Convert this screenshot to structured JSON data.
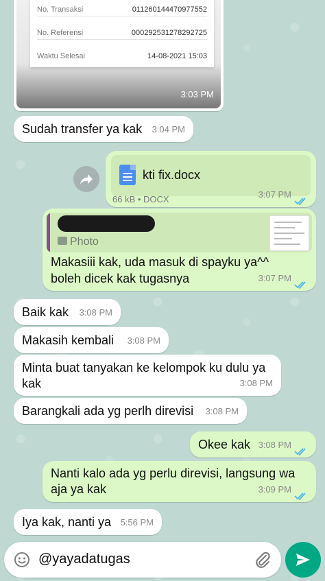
{
  "receipt": {
    "rows": [
      {
        "label": "No. Transaksi",
        "value": "011260144470977552"
      },
      {
        "label": "No. Referensi",
        "value": "000292531278292725"
      },
      {
        "label": "Waktu Selesai",
        "value": "14-08-2021 15:03"
      }
    ],
    "time": "3:03 PM"
  },
  "messages": [
    {
      "text": "Sudah transfer ya kak",
      "time": "3:04 PM"
    },
    {
      "file_name": "kti fix.docx",
      "file_meta": "66 kB • DOCX",
      "time": "3:07 PM"
    },
    {
      "quote_label": "Photo",
      "line1": "Makasiii kak, uda masuk di spayku ya^^",
      "line2": "boleh dicek kak tugasnya",
      "time": "3:07 PM"
    },
    {
      "text": "Baik kak",
      "time": "3:08 PM"
    },
    {
      "text": "Makasih kembali",
      "time": "3:08 PM"
    },
    {
      "line1": "Minta buat tanyakan ke kelompok ku dulu ya",
      "line2": "kak",
      "time": "3:08 PM"
    },
    {
      "text": "Barangkali ada yg perlh direvisi",
      "time": "3:08 PM"
    },
    {
      "text": "Okee kak",
      "time": "3:08 PM"
    },
    {
      "line1": "Nanti kalo ada yg perlu direvisi, langsung wa",
      "line2": "aja ya kak",
      "time": "3:09 PM"
    },
    {
      "text": "Iya kak, nanti ya",
      "time": "5:56 PM"
    }
  ],
  "composer": {
    "value": "@yayadatugas",
    "icons": {
      "emoji": "emoji-icon",
      "attach": "paperclip-icon",
      "send": "send-icon"
    }
  },
  "colors": {
    "incoming": "#ffffff",
    "outgoing": "#dcf8c6",
    "tick": "#4fb6ec",
    "send": "#00a884"
  }
}
